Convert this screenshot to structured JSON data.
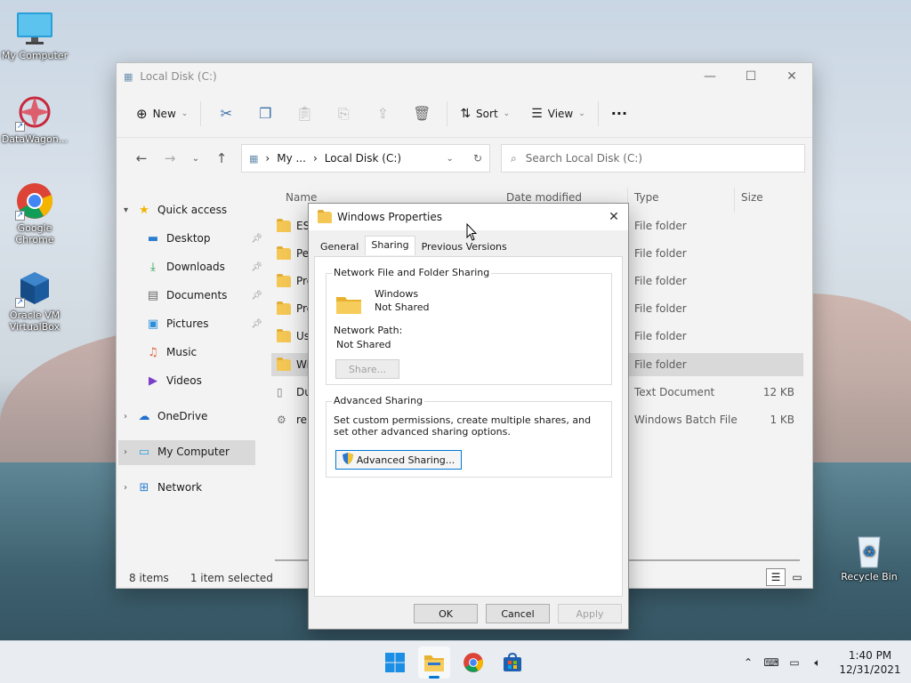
{
  "desktop": {
    "icons": [
      {
        "label": "My Computer"
      },
      {
        "label": "DataWagon..."
      },
      {
        "label": "Google Chrome"
      },
      {
        "label": "Oracle VM VirtualBox"
      },
      {
        "label": "Recycle Bin"
      }
    ]
  },
  "explorer": {
    "title": "Local Disk (C:)",
    "toolbar": {
      "new_label": "New",
      "sort_label": "Sort",
      "view_label": "View",
      "more_label": "···"
    },
    "address": {
      "crumb1": "My ...",
      "crumb2": "Local Disk (C:)"
    },
    "search_placeholder": "Search Local Disk (C:)",
    "sidebar": {
      "quick_access": "Quick access",
      "items": [
        "Desktop",
        "Downloads",
        "Documents",
        "Pictures",
        "Music",
        "Videos"
      ],
      "onedrive": "OneDrive",
      "my_computer": "My Computer",
      "network": "Network"
    },
    "columns": {
      "name": "Name",
      "date": "Date modified",
      "type": "Type",
      "size": "Size"
    },
    "files": [
      {
        "name": "ESD",
        "type": "File folder",
        "size": ""
      },
      {
        "name": "Per",
        "type": "File folder",
        "size": ""
      },
      {
        "name": "Pro",
        "type": "File folder",
        "size": ""
      },
      {
        "name": "Pro",
        "type": "File folder",
        "size": ""
      },
      {
        "name": "Use",
        "type": "File folder",
        "size": ""
      },
      {
        "name": "Win",
        "type": "File folder",
        "size": ""
      },
      {
        "name": "Dur",
        "type": "Text Document",
        "size": "12 KB"
      },
      {
        "name": "reb",
        "type": "Windows Batch File",
        "size": "1 KB"
      }
    ],
    "status": {
      "count": "8 items",
      "selected": "1 item selected"
    }
  },
  "dialog": {
    "title": "Windows Properties",
    "tabs": [
      "General",
      "Sharing",
      "Previous Versions"
    ],
    "nffs_label": "Network File and Folder Sharing",
    "folder_name": "Windows",
    "folder_state": "Not Shared",
    "network_path_label": "Network Path:",
    "network_path_value": "Not Shared",
    "share_btn": "Share...",
    "adv_label": "Advanced Sharing",
    "adv_desc": "Set custom permissions, create multiple shares, and set other advanced sharing options.",
    "adv_btn": "Advanced Sharing...",
    "ok": "OK",
    "cancel": "Cancel",
    "apply": "Apply"
  },
  "taskbar": {
    "time": "1:40 PM",
    "date": "12/31/2021"
  },
  "colors": {
    "accent": "#0078d4",
    "folder": "#f4c653"
  }
}
